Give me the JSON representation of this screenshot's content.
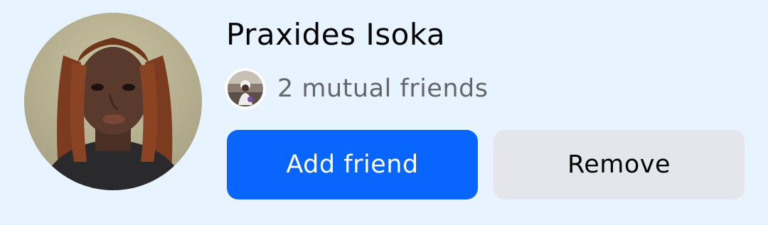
{
  "friend_request": {
    "name": "Praxides Isoka",
    "mutual_friends_label": "2 mutual friends",
    "add_friend_label": "Add friend",
    "remove_label": "Remove"
  },
  "icons": {
    "profile_photo": "profile-photo",
    "mutual_friend_avatar": "mutual-friend-avatar"
  },
  "colors": {
    "background": "#E7F3FF",
    "primary_button": "#0866FF",
    "secondary_button": "#E4E6EB",
    "name_text": "#050505",
    "meta_text": "#65676B"
  }
}
